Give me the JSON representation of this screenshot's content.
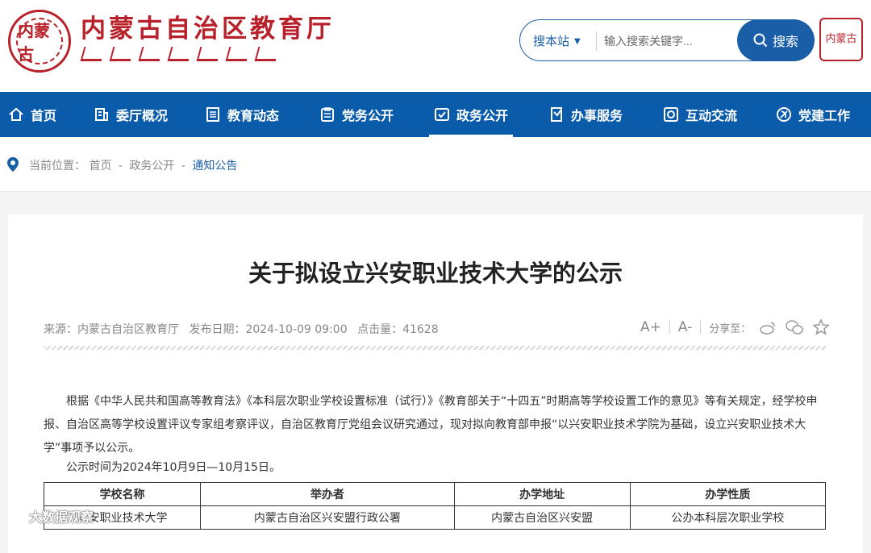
{
  "header": {
    "logo_text": "内蒙古",
    "site_title": "内蒙古自治区教育厅",
    "stamp_text": "内蒙古"
  },
  "search": {
    "site_selector": "搜本站",
    "placeholder": "输入搜索关键字...",
    "button_label": "搜索"
  },
  "nav": {
    "items": [
      {
        "label": "首页",
        "icon": "home-icon"
      },
      {
        "label": "委厅概况",
        "icon": "building-icon"
      },
      {
        "label": "教育动态",
        "icon": "list-icon"
      },
      {
        "label": "党务公开",
        "icon": "clipboard-icon"
      },
      {
        "label": "政务公开",
        "icon": "check-board-icon"
      },
      {
        "label": "办事服务",
        "icon": "edit-doc-icon"
      },
      {
        "label": "互动交流",
        "icon": "chat-icon"
      },
      {
        "label": "党建工作",
        "icon": "party-emblem-icon"
      }
    ],
    "active_index": 4
  },
  "breadcrumb": {
    "prefix": "当前位置：",
    "items": [
      "首页",
      "政务公开",
      "通知公告"
    ],
    "separator": "-"
  },
  "article": {
    "title": "关于拟设立兴安职业技术大学的公示",
    "source": "来源：内蒙古自治区教育厅",
    "publish_date": "发布日期：2024-10-09 09:00",
    "views": "点击量：41628",
    "font_increase": "A+",
    "font_decrease": "A-",
    "share_label": "分享至：",
    "paragraph_1": "根据《中华人民共和国高等教育法》《本科层次职业学校设置标准（试行）》《教育部关于“十四五”时期高等学校设置工作的意见》等有关规定，经学校申报、自治区高等学校设置评议专家组考察评议，自治区教育厅党组会议研究通过，现对拟向教育部申报“以兴安职业技术学院为基础，设立兴安职业技术大学”事项予以公示。",
    "paragraph_2": "公示时间为2024年10月9日—10月15日。",
    "table": {
      "headers": [
        "学校名称",
        "举办者",
        "办学地址",
        "办学性质"
      ],
      "rows": [
        [
          "兴安职业技术大学",
          "内蒙古自治区兴安盟行政公署",
          "内蒙古自治区兴安盟",
          "公办本科层次职业学校"
        ]
      ]
    }
  },
  "watermark": "大数据观察"
}
